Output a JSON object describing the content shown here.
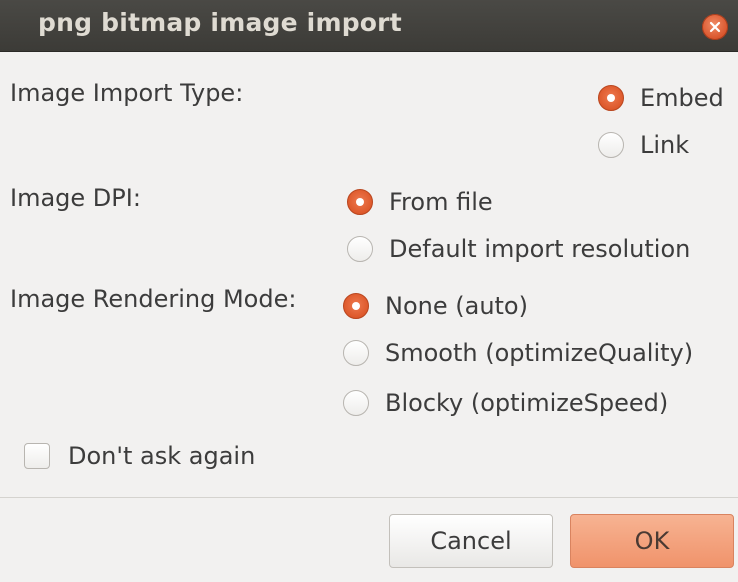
{
  "window": {
    "title": "png bitmap image import",
    "close_icon": "close-icon",
    "accent_color": "#e0602e"
  },
  "import_type": {
    "label": "Image Import Type:",
    "options": [
      {
        "label": "Embed",
        "selected": true
      },
      {
        "label": "Link",
        "selected": false
      }
    ]
  },
  "dpi": {
    "label": "Image DPI:",
    "options": [
      {
        "label": "From file",
        "selected": true
      },
      {
        "label": "Default import resolution",
        "selected": false
      }
    ]
  },
  "rendering": {
    "label": "Image Rendering Mode:",
    "options": [
      {
        "label": "None (auto)",
        "selected": true
      },
      {
        "label": "Smooth (optimizeQuality)",
        "selected": false
      },
      {
        "label": "Blocky (optimizeSpeed)",
        "selected": false
      }
    ]
  },
  "dont_ask": {
    "label": "Don't ask again",
    "checked": false
  },
  "buttons": {
    "cancel": "Cancel",
    "ok": "OK"
  }
}
